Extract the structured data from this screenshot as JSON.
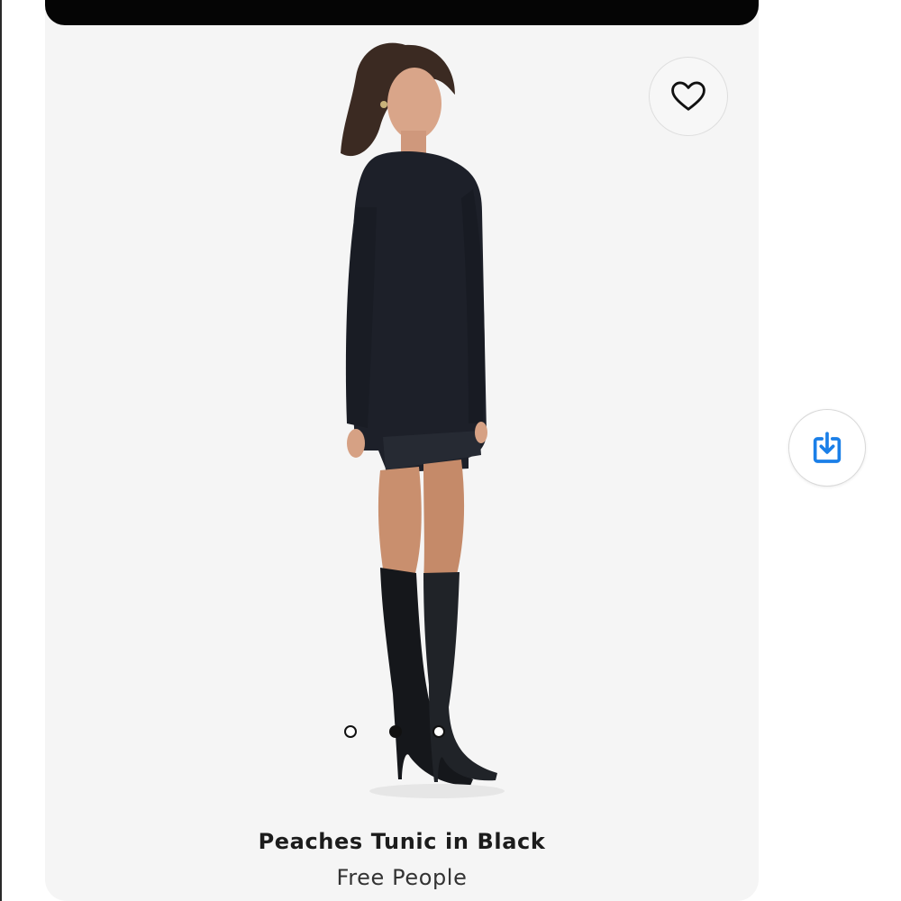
{
  "product": {
    "title": "Peaches Tunic in Black",
    "brand": "Free People"
  },
  "icons": {
    "favorite": "heart-outline-icon",
    "save": "download-tray-icon"
  },
  "carousel": {
    "total": 3,
    "active_index": 2
  },
  "colors": {
    "card_background": "#f5f5f5",
    "top_bar": "#050505",
    "save_accent": "#1a7fe8",
    "text_primary": "#1c1c1c"
  }
}
